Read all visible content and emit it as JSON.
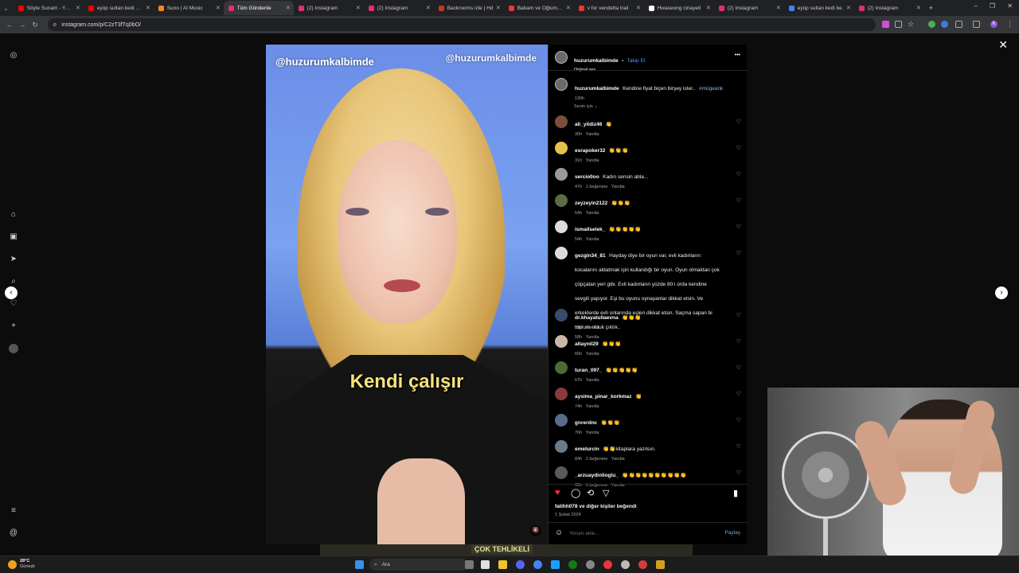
{
  "tabs": [
    {
      "label": "Söyle Sunam - YouT",
      "color": "#ff0000",
      "active": false
    },
    {
      "label": "eyüp sultan kedi bes",
      "color": "#ff0000",
      "active": false
    },
    {
      "label": "Suno | AI Music",
      "color": "#f08a24",
      "active": false
    },
    {
      "label": "Tüm Gönderile",
      "color": "#e1306c",
      "active": true
    },
    {
      "label": "(2) Instagram",
      "color": "#e1306c",
      "active": false
    },
    {
      "label": "(2) Instagram",
      "color": "#e1306c",
      "active": false
    },
    {
      "label": "Backrooms izle | Hd",
      "color": "#c0392b",
      "active": false
    },
    {
      "label": "Babam ve Oğlum | F",
      "color": "#e53935",
      "active": false
    },
    {
      "label": "v for vendetta trail",
      "color": "#e53935",
      "active": false
    },
    {
      "label": "Hwaseong cinayetl",
      "color": "#ffffff",
      "active": false
    },
    {
      "label": "(2) Instagram",
      "color": "#e1306c",
      "active": false
    },
    {
      "label": "eyüp sultan kedi be",
      "color": "#4285f4",
      "active": false
    },
    {
      "label": "(2) Instagram",
      "color": "#e1306c",
      "active": false
    }
  ],
  "new_tab": "+",
  "window_controls": {
    "minimize": "–",
    "restore": "❐",
    "close": "✕"
  },
  "address": {
    "url": "instagram.com/p/C2zT3fTq0bO/"
  },
  "close_label": "✕",
  "video": {
    "watermark_left": "@huzurumkalbimde",
    "watermark_right": "@huzurumkalbimde",
    "caption": "Kendi çalışır",
    "bottom_text": "ÇOK TEHLİKELİ"
  },
  "post": {
    "author": "huzurumkalbimde",
    "follow": "Takip Et",
    "dot": "•",
    "audio": "Orijinal ses",
    "caption_user": "huzurumkalbimde",
    "caption_text": "Kendine fiyat biçen birşey ister..",
    "caption_tag": "#müge",
    "caption_tag2": "ank",
    "caption_time": "130h",
    "sort": "Senin için ⌄",
    "more": "•••"
  },
  "comments": [
    {
      "user": "ali_yildiz46",
      "text": "👏",
      "time": "30h",
      "reply": "Yanıtla",
      "likes": "",
      "avatar": "#7a4e3a"
    },
    {
      "user": "esrapoker32",
      "text": "👏👏👏",
      "time": "31h",
      "reply": "Yanıtla",
      "likes": "",
      "avatar": "#e6c24a"
    },
    {
      "user": "sercio0oo",
      "text": "Kadın sensin abla...",
      "time": "47h",
      "reply": "Yanıtla",
      "likes": "1 beğenme",
      "avatar": "#9a9a9a"
    },
    {
      "user": "zeyzeyin2122",
      "text": "👏👏👏",
      "time": "54h",
      "reply": "Yanıtla",
      "likes": "",
      "avatar": "#5d6b4a"
    },
    {
      "user": "ismailselek_",
      "text": "👏👏👏👏👏",
      "time": "54h",
      "reply": "Yanıtla",
      "likes": "",
      "avatar": "#dcdcdc"
    },
    {
      "user": "gezgin34_81",
      "text": "Hayday diye bir oyun var, evli kadınların kocalarını aldatmak için kullandığı bir oyun. Oyun olmaktan çok çöpçatan yeri gibi. Evli kadınların yüzde 80 i orda kendine sevgili yapıyor. Eşi bu oyunu oynayanlar dikkat etsin. Ve erkeklerde evli onlarında eşleri dikkat etsin. Saçma sapan bi toplum olduk çıktık..",
      "time": "58h",
      "reply": "Yanıtla",
      "likes": "",
      "avatar": "#dcdcdc"
    },
    {
      "user": "dr.khayatullaevna",
      "text": "👏👏👏",
      "time": "59h",
      "reply": "Yanıtla",
      "likes": "",
      "avatar": "#3a4a6a"
    },
    {
      "user": "altaynil29",
      "text": "👏👏👏",
      "time": "65h",
      "reply": "Yanıtla",
      "likes": "",
      "avatar": "#c8b8a8"
    },
    {
      "user": "turan_097_",
      "text": "👏👏👏👏👏",
      "time": "67h",
      "reply": "Yanıtla",
      "likes": "",
      "avatar": "#4a6a3a"
    },
    {
      "user": "aysima_pinar_korkmaz",
      "text": "👏",
      "time": "74h",
      "reply": "Yanıtla",
      "likes": "",
      "avatar": "#8a3a3a"
    },
    {
      "user": "gnrerdnc",
      "text": "👏👏👏",
      "time": "76h",
      "reply": "Yanıtla",
      "likes": "",
      "avatar": "#5a6a8a"
    },
    {
      "user": "emelurcin",
      "text": "👏👏kitaplara yazılsın.",
      "time": "84h",
      "reply": "Yanıtla",
      "likes": "2 beğenme",
      "avatar": "#6a7a8a"
    },
    {
      "user": "_arzuaydinlioglu_",
      "text": "👏👏👏👏👏👏👏👏👏👏",
      "time": "93h",
      "reply": "Yanıtla",
      "likes": "1 beğenme",
      "avatar": "#5a5a5a"
    }
  ],
  "likes_line": {
    "user": "fatihh078",
    "rest": "ve diğer kişiler beğendi"
  },
  "date": "1 Şubat 2024",
  "add_comment": {
    "placeholder": "Yorum ekle...",
    "share": "Paylaş"
  },
  "weather": {
    "temp": "28°C",
    "desc": "Güneşli"
  },
  "search": {
    "label": "Ara"
  }
}
